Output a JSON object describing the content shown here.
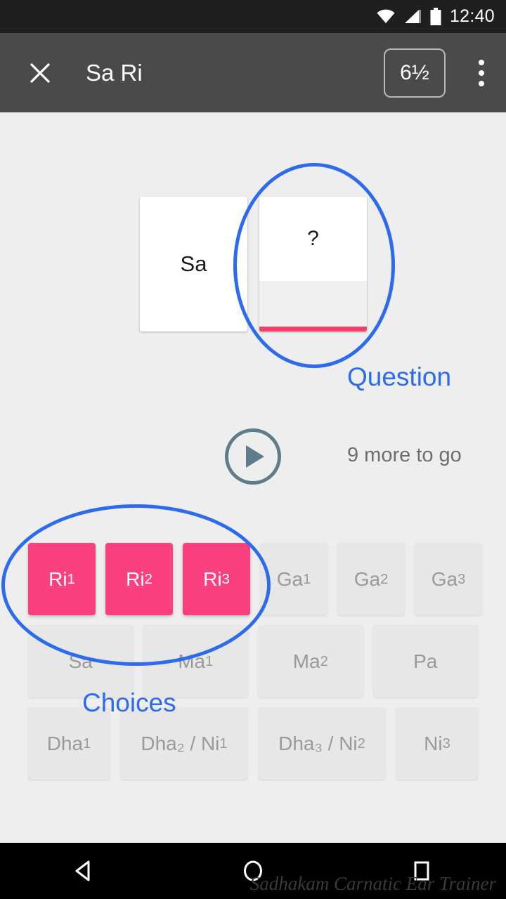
{
  "status_bar": {
    "time": "12:40",
    "icons": [
      "wifi-icon",
      "cell-signal-icon",
      "battery-icon"
    ]
  },
  "app_bar": {
    "close_icon": "close-icon",
    "title": "Sa Ri",
    "octave_badge": "6½",
    "overflow_icon": "overflow-menu-icon"
  },
  "exercise": {
    "cards": [
      {
        "label": "Sa",
        "state": "answered"
      },
      {
        "label": "?",
        "state": "question"
      }
    ],
    "play_button_label": "play-icon",
    "progress_text": "9 more to go"
  },
  "annotations": {
    "question": "Question",
    "choices": "Choices"
  },
  "choices": {
    "rows": [
      [
        {
          "base": "Ri",
          "sub": "1",
          "state": "active"
        },
        {
          "base": "Ri",
          "sub": "2",
          "state": "active"
        },
        {
          "base": "Ri",
          "sub": "3",
          "state": "active"
        },
        {
          "base": "Ga",
          "sub": "1",
          "state": "disabled"
        },
        {
          "base": "Ga",
          "sub": "2",
          "state": "disabled"
        },
        {
          "base": "Ga",
          "sub": "3",
          "state": "disabled"
        }
      ],
      [
        {
          "base": "Sa",
          "sub": "",
          "state": "disabled"
        },
        {
          "base": "Ma",
          "sub": "1",
          "state": "disabled"
        },
        {
          "base": "Ma",
          "sub": "2",
          "state": "disabled"
        },
        {
          "base": "Pa",
          "sub": "",
          "state": "disabled"
        }
      ],
      [
        {
          "base": "Dha",
          "sub": "1",
          "state": "disabled"
        },
        {
          "base": "Dha₂ / Ni",
          "sub": "1",
          "state": "disabled",
          "raw": "Dha2 / Ni1"
        },
        {
          "base": "Dha₃ / Ni",
          "sub": "2",
          "state": "disabled",
          "raw": "Dha3 / Ni2"
        },
        {
          "base": "Ni",
          "sub": "3",
          "state": "disabled"
        }
      ]
    ]
  },
  "watermark": "Sadhakam Carnatic Ear Trainer",
  "nav_bar": {
    "back": "back-triangle-icon",
    "home": "home-circle-icon",
    "recents": "recents-square-icon"
  },
  "colors": {
    "accent_pink": "#FB4080",
    "annotation_blue": "#2D6BEE",
    "app_bar": "#4A4A4A",
    "background": "#EEEEEE",
    "play_button": "#5E7C8B"
  }
}
